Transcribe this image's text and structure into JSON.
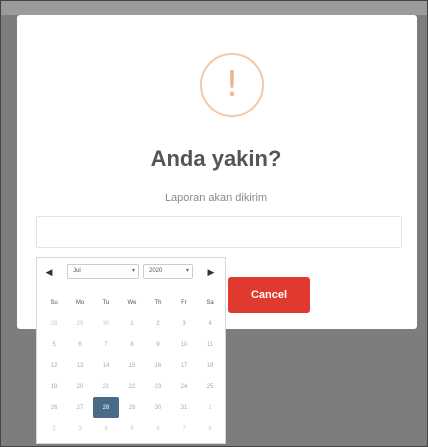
{
  "dialog": {
    "title": "Anda yakin?",
    "message": "Laporan akan dikirim",
    "warning_glyph": "!",
    "warning_icon": "exclamation-circle-icon",
    "cancel_label": "Cancel",
    "cancel_color": "#e0392f",
    "date_input_value": ""
  },
  "calendar": {
    "prev_glyph": "◀",
    "next_glyph": "▶",
    "month": "Jul",
    "year": "2020",
    "weekdays": [
      "Su",
      "Mo",
      "Tu",
      "We",
      "Th",
      "Fr",
      "Sa"
    ],
    "weeks": [
      [
        "28",
        "29",
        "30",
        "1",
        "2",
        "3",
        "4"
      ],
      [
        "5",
        "6",
        "7",
        "8",
        "9",
        "10",
        "11"
      ],
      [
        "12",
        "13",
        "14",
        "15",
        "16",
        "17",
        "18"
      ],
      [
        "19",
        "20",
        "21",
        "22",
        "23",
        "24",
        "25"
      ],
      [
        "26",
        "27",
        "28",
        "29",
        "30",
        "31",
        "1"
      ],
      [
        "2",
        "3",
        "4",
        "5",
        "6",
        "7",
        "8"
      ]
    ],
    "selected_day": "28",
    "selected_color": "#4a6a8a"
  }
}
